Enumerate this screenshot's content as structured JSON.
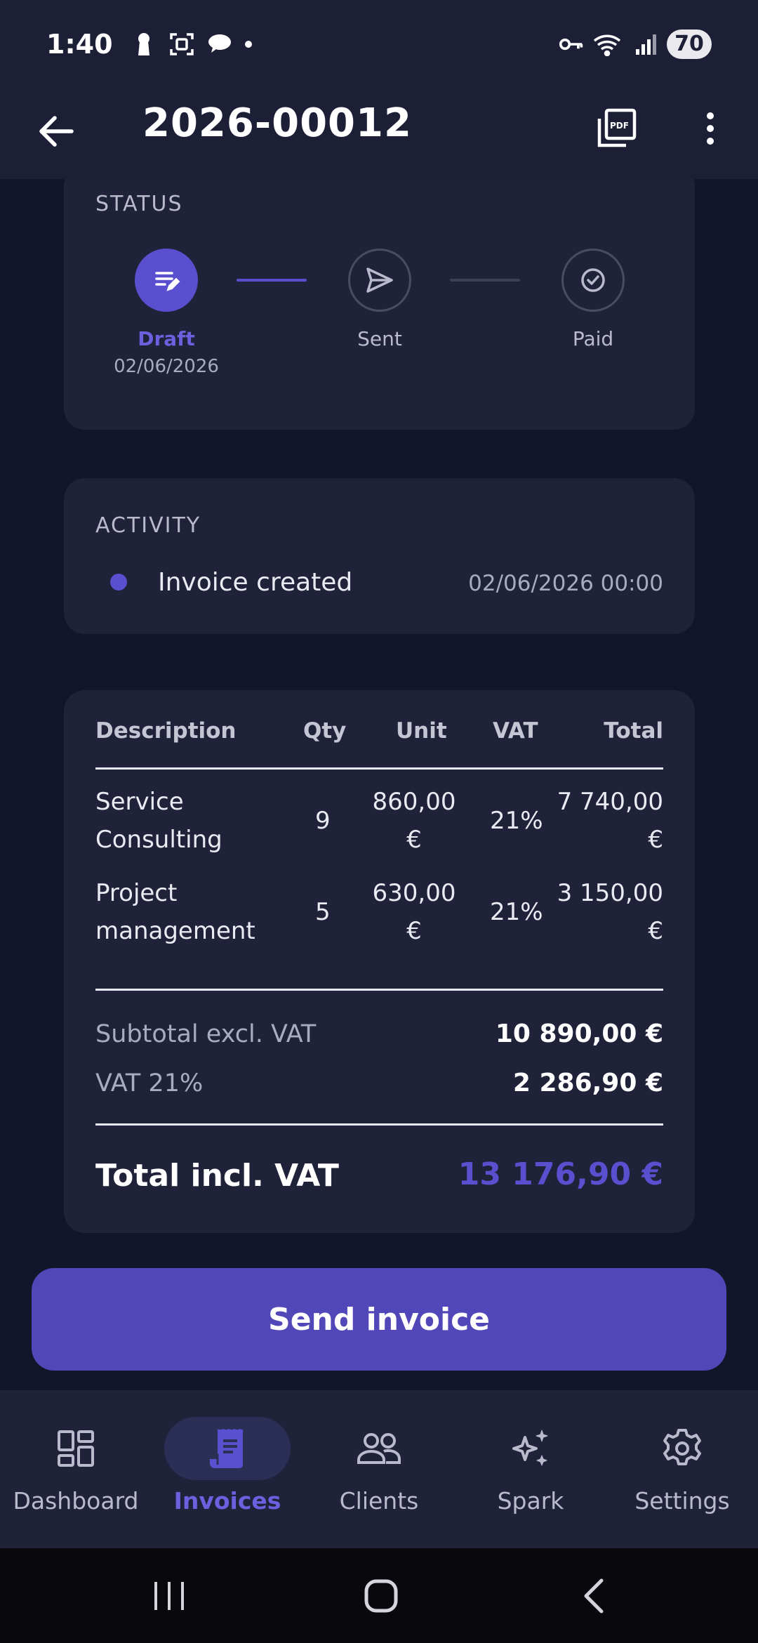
{
  "status_bar": {
    "time": "1:40",
    "battery": "70"
  },
  "app_bar": {
    "title": "2026-00012"
  },
  "status": {
    "label": "STATUS",
    "steps": [
      {
        "label": "Draft",
        "date": "02/06/2026",
        "active": true
      },
      {
        "label": "Sent",
        "date": "",
        "active": false
      },
      {
        "label": "Paid",
        "date": "",
        "active": false
      }
    ]
  },
  "activity": {
    "label": "ACTIVITY",
    "items": [
      {
        "text": "Invoice created",
        "date": "02/06/2026 00:00"
      }
    ]
  },
  "items_table": {
    "headers": {
      "description": "Description",
      "qty": "Qty",
      "unit": "Unit",
      "vat": "VAT",
      "total": "Total"
    },
    "rows": [
      {
        "description_line1": "Service",
        "description_line2": "Consulting",
        "qty": "9",
        "unit_line1": "860,00",
        "unit_line2": "€",
        "vat": "21%",
        "total_line1": "7 740,00",
        "total_line2": "€"
      },
      {
        "description_line1": "Project",
        "description_line2": "management",
        "qty": "5",
        "unit_line1": "630,00",
        "unit_line2": "€",
        "vat": "21%",
        "total_line1": "3 150,00",
        "total_line2": "€"
      }
    ]
  },
  "summary": {
    "subtotal_label": "Subtotal excl. VAT",
    "subtotal_value": "10 890,00 €",
    "vat_label": "VAT 21%",
    "vat_value": "2 286,90 €",
    "total_label": "Total incl. VAT",
    "total_value": "13 176,90 €"
  },
  "actions": {
    "send_label": "Send invoice"
  },
  "bottom_nav": {
    "items": [
      {
        "label": "Dashboard",
        "icon": "dashboard-icon",
        "active": false
      },
      {
        "label": "Invoices",
        "icon": "receipt-icon",
        "active": true
      },
      {
        "label": "Clients",
        "icon": "people-icon",
        "active": false
      },
      {
        "label": "Spark",
        "icon": "sparkle-icon",
        "active": false
      },
      {
        "label": "Settings",
        "icon": "gear-icon",
        "active": false
      }
    ]
  },
  "colors": {
    "background": "#13162a",
    "surface": "#1f2239",
    "accent": "#5a4fcf",
    "button": "#5247b8"
  }
}
